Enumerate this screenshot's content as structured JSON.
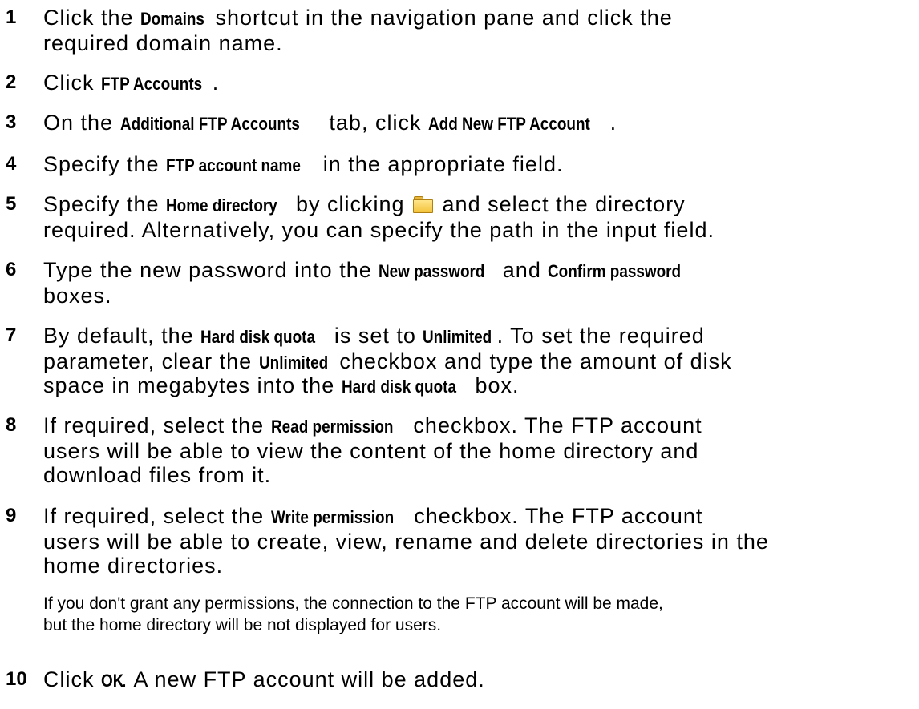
{
  "steps": [
    {
      "n": "1",
      "lines": [
        [
          {
            "t": "Click the "
          },
          {
            "t": "Domains",
            "b": 1
          },
          {
            "t": " shortcut in the navigation pane and click the"
          }
        ],
        [
          {
            "t": "required domain name."
          }
        ]
      ]
    },
    {
      "n": "2",
      "lines": [
        [
          {
            "t": "Click "
          },
          {
            "t": "FTP Accounts",
            "b": 1
          },
          {
            "t": "."
          }
        ]
      ]
    },
    {
      "n": "3",
      "lines": [
        [
          {
            "t": "On the "
          },
          {
            "t": "Additional FTP Accounts",
            "b": 1
          },
          {
            "t": " tab, click "
          },
          {
            "t": "Add New FTP Account",
            "b": 1
          },
          {
            "t": "."
          }
        ]
      ]
    },
    {
      "n": "4",
      "lines": [
        [
          {
            "t": "Specify the "
          },
          {
            "t": "FTP account name",
            "b": 1
          },
          {
            "t": " in the appropriate field."
          }
        ]
      ]
    },
    {
      "n": "5",
      "lines": [
        [
          {
            "t": "Specify the "
          },
          {
            "t": "Home directory",
            "b": 1
          },
          {
            "t": " by clicking "
          },
          {
            "icon": "folder-icon"
          },
          {
            "t": " and select the directory"
          }
        ],
        [
          {
            "t": "required. Alternatively, you can specify the path in the input field."
          }
        ]
      ]
    },
    {
      "n": "6",
      "lines": [
        [
          {
            "t": "Type the new password into the "
          },
          {
            "t": "New password",
            "b": 1
          },
          {
            "t": " and "
          },
          {
            "t": "Confirm password",
            "b": 1
          }
        ],
        [
          {
            "t": "boxes."
          }
        ]
      ]
    },
    {
      "n": "7",
      "lines": [
        [
          {
            "t": "By default, the "
          },
          {
            "t": "Hard disk quota",
            "b": 1
          },
          {
            "t": " is set to "
          },
          {
            "t": "Unlimited",
            "b": 1
          },
          {
            "t": ". To set the required"
          }
        ],
        [
          {
            "t": "parameter, clear the "
          },
          {
            "t": "Unlimited",
            "b": 1
          },
          {
            "t": " checkbox and type the amount of disk"
          }
        ],
        [
          {
            "t": "space in megabytes into the "
          },
          {
            "t": "Hard disk quota",
            "b": 1
          },
          {
            "t": " box."
          }
        ]
      ]
    },
    {
      "n": "8",
      "lines": [
        [
          {
            "t": "If required, select the "
          },
          {
            "t": "Read permission",
            "b": 1
          },
          {
            "t": " checkbox. The FTP account"
          }
        ],
        [
          {
            "t": "users will be able to view the content of the home directory and"
          }
        ],
        [
          {
            "t": "download files from it."
          }
        ]
      ]
    },
    {
      "n": "9",
      "lines": [
        [
          {
            "t": "If required, select the "
          },
          {
            "t": "Write permission",
            "b": 1
          },
          {
            "t": " checkbox. The FTP account"
          }
        ],
        [
          {
            "t": "users will be able to create, view, rename and delete directories in the"
          }
        ],
        [
          {
            "t": "home directories."
          }
        ]
      ]
    },
    {
      "n": "10",
      "lines": [
        [
          {
            "t": "Click "
          },
          {
            "t": "OK",
            "b": 1
          },
          {
            "t": ". A new FTP account will be added."
          }
        ]
      ]
    }
  ],
  "note": {
    "line1": "If you don't grant any permissions, the connection to the FTP account will be made,",
    "line2": "but the home directory will be not displayed for users."
  }
}
